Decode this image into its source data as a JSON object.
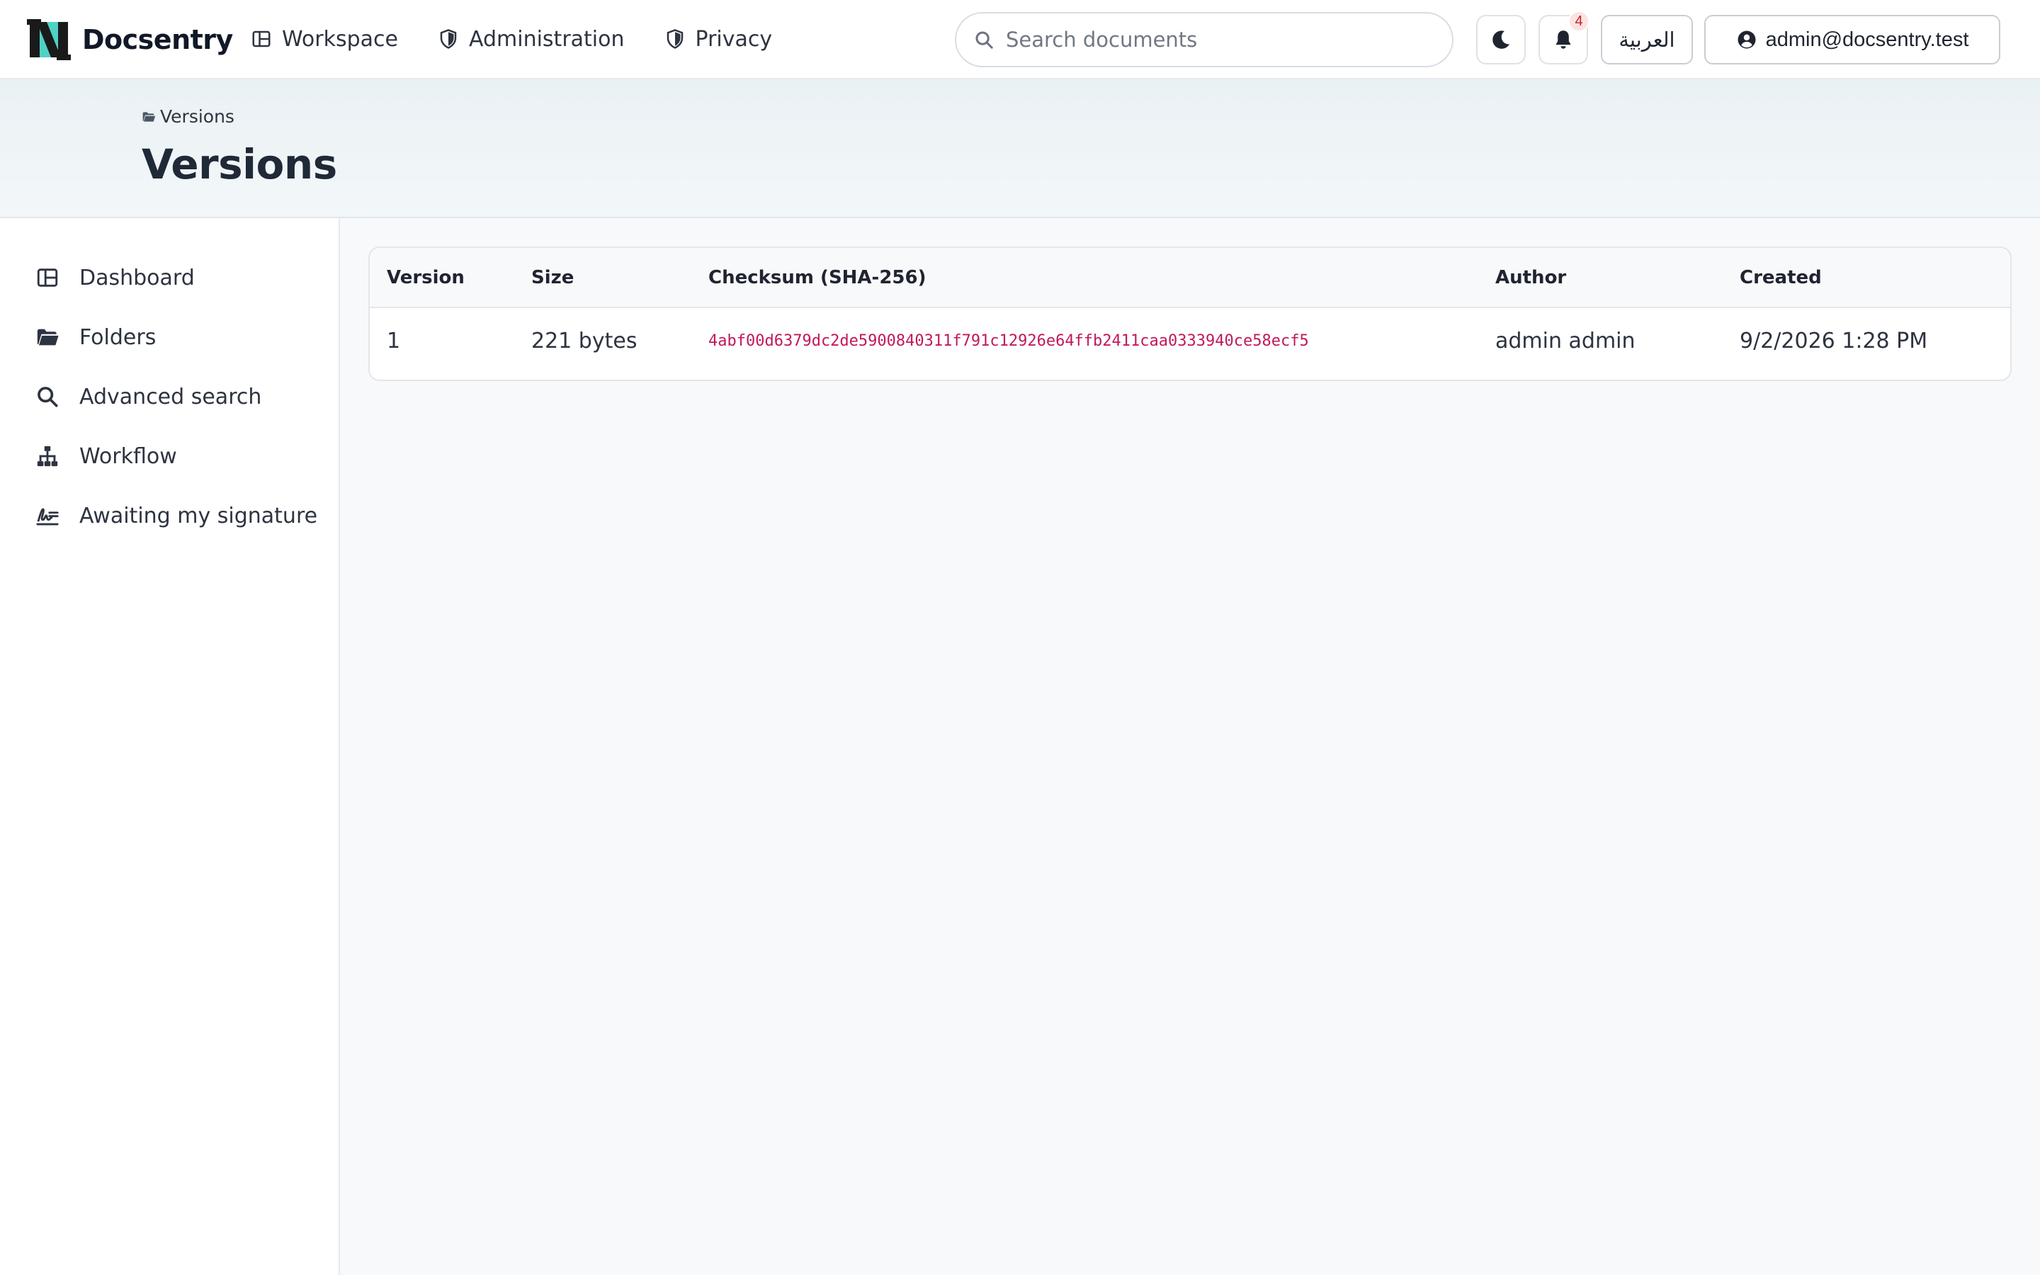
{
  "app": {
    "name": "Docsentry"
  },
  "nav": {
    "items": [
      {
        "label": "Workspace",
        "icon": "workspace-icon"
      },
      {
        "label": "Administration",
        "icon": "shield-icon"
      },
      {
        "label": "Privacy",
        "icon": "shield-icon"
      }
    ]
  },
  "search": {
    "placeholder": "Search documents",
    "value": ""
  },
  "header_actions": {
    "notifications_count": "4",
    "language_label": "العربية",
    "user_label": "admin@docsentry.test"
  },
  "breadcrumb": {
    "label": "Versions"
  },
  "page": {
    "title": "Versions"
  },
  "sidebar": {
    "items": [
      {
        "label": "Dashboard",
        "icon": "dashboard-icon"
      },
      {
        "label": "Folders",
        "icon": "folder-icon"
      },
      {
        "label": "Advanced search",
        "icon": "search-icon"
      },
      {
        "label": "Workflow",
        "icon": "workflow-icon"
      },
      {
        "label": "Awaiting my signature",
        "icon": "signature-icon"
      }
    ]
  },
  "versions_table": {
    "columns": [
      "Version",
      "Size",
      "Checksum (SHA-256)",
      "Author",
      "Created"
    ],
    "rows": [
      {
        "version": "1",
        "size": "221 bytes",
        "checksum": "4abf00d6379dc2de5900840311f791c12926e64ffb2411caa0333940ce58ecf5",
        "author": "admin admin",
        "created": "9/2/2026 1:28 PM"
      }
    ]
  },
  "colors": {
    "checksum": "#c2185b",
    "logo_accent": "#4fd1c5",
    "badge_bg": "#fde2e2"
  }
}
